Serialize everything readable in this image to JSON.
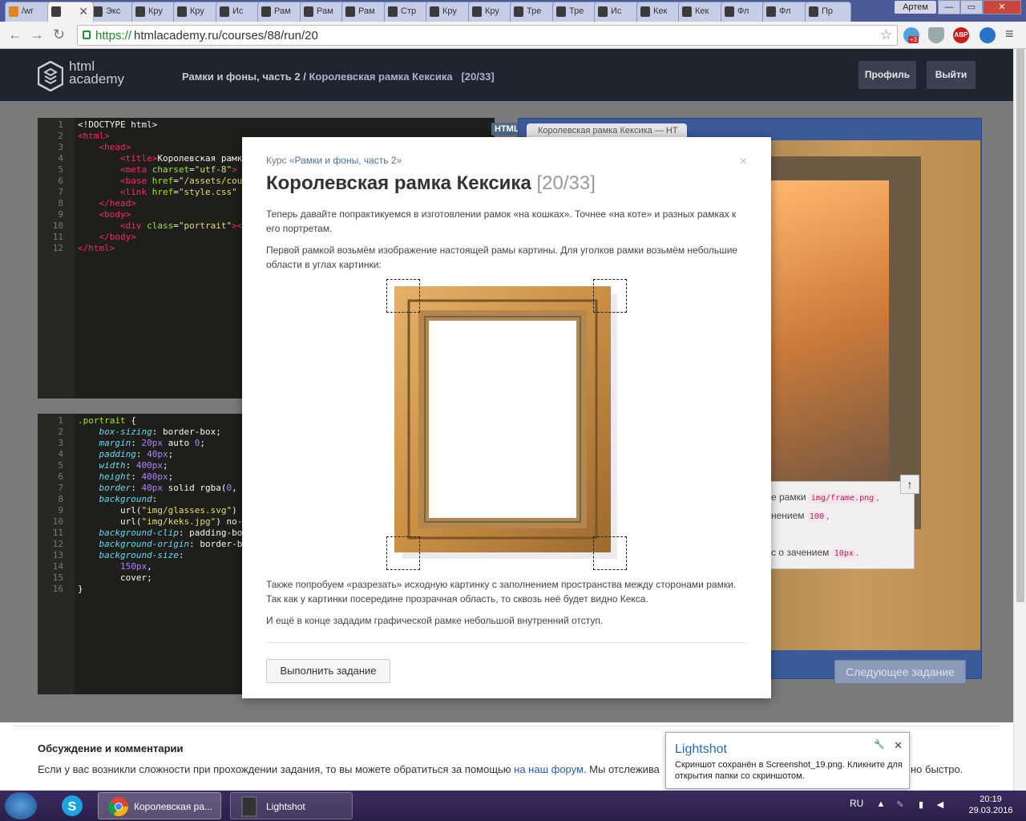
{
  "browser": {
    "tabs": [
      "/wr",
      "",
      "Экс",
      "Кру",
      "Кру",
      "Ис",
      "Рам",
      "Рам",
      "Рам",
      "Стр",
      "Кру",
      "Кру",
      "Тре",
      "Тре",
      "Ис",
      "Кек",
      "Кек",
      "Фл",
      "Фл",
      "Пр"
    ],
    "user": "Артем",
    "url_protocol": "https://",
    "url_rest": "htmlacademy.ru/courses/88/run/20",
    "ext_abp": "ABP",
    "ext_cloud_badge": "+3"
  },
  "site": {
    "logo": [
      "html",
      "academy"
    ],
    "breadcrumb_course": "Рамки и фоны, часть 2",
    "breadcrumb_sep": " / ",
    "breadcrumb_task": "Королевская рамка Кексика",
    "breadcrumb_counter": "[20/33]",
    "profile_button": "Профиль",
    "logout_button": "Выйти"
  },
  "editor_html": {
    "badge": "HTML",
    "line_numbers": [
      "1",
      "2",
      "3",
      "4",
      "5",
      "6",
      "7",
      "8",
      "9",
      "10",
      "11",
      "12"
    ]
  },
  "editor_css": {
    "line_numbers": [
      "1",
      "2",
      "3",
      "4",
      "5",
      "6",
      "7",
      "8",
      "9",
      "10",
      "11",
      "12",
      "13",
      "14",
      "15",
      "16"
    ]
  },
  "preview": {
    "tab_title": "Королевская рамка Кексика — HT",
    "task_lines": [
      {
        "text": "е рамки",
        "chip": "img/frame.png",
        "tail": ","
      },
      {
        "text": "нением",
        "chip": "100",
        "tail": ","
      },
      {
        "text": "с о зачением",
        "chip": "10px",
        "tail": "."
      }
    ],
    "up_button": "↑",
    "next_button": "Следующее задание"
  },
  "modal": {
    "course_prefix": "Курс «",
    "course_link": "Рамки и фоны, часть 2",
    "course_suffix": "»",
    "title": "Королевская рамка Кексика",
    "counter": "[20/33]",
    "para1": "Теперь давайте попрактикуемся в изготовлении рамок «на кошках». Точнее «на коте» и разных рамках к его портретам.",
    "para2": "Первой рамкой возьмём изображение настоящей рамы картины. Для уголков рамки возьмём небольшие области в углах картинки:",
    "para3": "Также попробуем «разрезать» исходную картинку с заполнением пространства между сторонами рамки. Так как у картинки посередине прозрачная область, то сквозь неё будет видно Кекса.",
    "para4": "И ещё в конце зададим графической рамке небольшой внутренний отступ.",
    "close": "×",
    "button": "Выполнить задание"
  },
  "discussion": {
    "title": "Обсуждение и комментарии",
    "text_before": "Если у вас возникли сложности при прохождении задания, то вы можете обратиться за помощью ",
    "link": "на наш форум",
    "text_after": ". Мы отслежива",
    "tail": "но быстро."
  },
  "toast": {
    "title": "Lightshot",
    "body": "Скриншот сохранён в Screenshot_19.png. Кликните для открытия папки со скриншотом.",
    "close": "✕",
    "pin": "🔧"
  },
  "taskbar": {
    "chrome_label": "Королевская ра...",
    "lightshot_label": "Lightshot",
    "lang": "RU",
    "time": "20:19",
    "date": "29.03.2016"
  }
}
